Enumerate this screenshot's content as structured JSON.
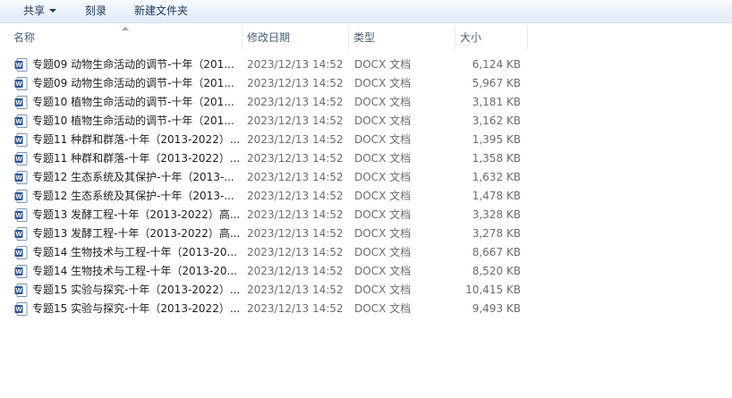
{
  "toolbar": {
    "share_label": "共享",
    "burn_label": "刻录",
    "new_folder_label": "新建文件夹"
  },
  "columns": {
    "name": "名称",
    "date": "修改日期",
    "type": "类型",
    "size": "大小"
  },
  "files": [
    {
      "name": "专题09 动物生命活动的调节-十年（201...",
      "date": "2023/12/13 14:52",
      "type": "DOCX 文档",
      "size": "6,124 KB"
    },
    {
      "name": "专题09 动物生命活动的调节-十年（201...",
      "date": "2023/12/13 14:52",
      "type": "DOCX 文档",
      "size": "5,967 KB"
    },
    {
      "name": "专题10 植物生命活动的调节-十年（201...",
      "date": "2023/12/13 14:52",
      "type": "DOCX 文档",
      "size": "3,181 KB"
    },
    {
      "name": "专题10 植物生命活动的调节-十年（201...",
      "date": "2023/12/13 14:52",
      "type": "DOCX 文档",
      "size": "3,162 KB"
    },
    {
      "name": "专题11 种群和群落-十年（2013-2022）...",
      "date": "2023/12/13 14:52",
      "type": "DOCX 文档",
      "size": "1,395 KB"
    },
    {
      "name": "专题11 种群和群落-十年（2013-2022）...",
      "date": "2023/12/13 14:52",
      "type": "DOCX 文档",
      "size": "1,358 KB"
    },
    {
      "name": "专题12 生态系统及其保护-十年（2013-...",
      "date": "2023/12/13 14:52",
      "type": "DOCX 文档",
      "size": "1,632 KB"
    },
    {
      "name": "专题12 生态系统及其保护-十年（2013-...",
      "date": "2023/12/13 14:52",
      "type": "DOCX 文档",
      "size": "1,478 KB"
    },
    {
      "name": "专题13 发酵工程-十年（2013-2022）高...",
      "date": "2023/12/13 14:52",
      "type": "DOCX 文档",
      "size": "3,328 KB"
    },
    {
      "name": "专题13 发酵工程-十年（2013-2022）高...",
      "date": "2023/12/13 14:52",
      "type": "DOCX 文档",
      "size": "3,278 KB"
    },
    {
      "name": "专题14 生物技术与工程-十年（2013-20...",
      "date": "2023/12/13 14:52",
      "type": "DOCX 文档",
      "size": "8,667 KB"
    },
    {
      "name": "专题14 生物技术与工程-十年（2013-20...",
      "date": "2023/12/13 14:52",
      "type": "DOCX 文档",
      "size": "8,520 KB"
    },
    {
      "name": "专题15 实验与探究-十年（2013-2022）...",
      "date": "2023/12/13 14:52",
      "type": "DOCX 文档",
      "size": "10,415 KB"
    },
    {
      "name": "专题15 实验与探究-十年（2013-2022）...",
      "date": "2023/12/13 14:52",
      "type": "DOCX 文档",
      "size": "9,493 KB"
    }
  ],
  "icons": {
    "file_icon": "word-document-icon",
    "share_dropdown": "chevron-down-icon",
    "sort_indicator": "sort-ascending-icon"
  },
  "colors": {
    "toolbar_text": "#1e395b",
    "header_text": "#4c607a",
    "word_blue": "#2b5797"
  }
}
